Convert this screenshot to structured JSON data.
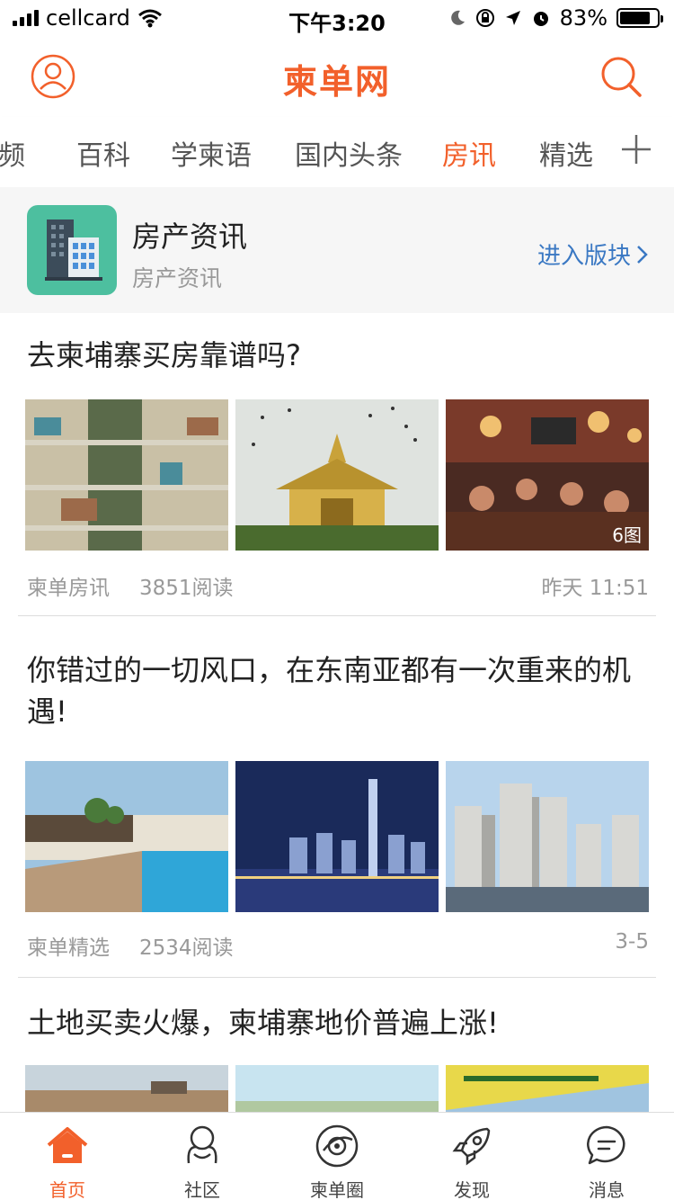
{
  "status_bar": {
    "carrier": "cellcard",
    "time": "下午3:20",
    "battery": "83%",
    "battery_level": 0.83
  },
  "header": {
    "logo": "柬单网",
    "profile_icon": "user-icon",
    "search_icon": "search-icon"
  },
  "tabs": [
    {
      "label": "视频"
    },
    {
      "label": "百科"
    },
    {
      "label": "学柬语"
    },
    {
      "label": "国内头条"
    },
    {
      "label": "房讯",
      "active": true
    },
    {
      "label": "精选"
    }
  ],
  "section": {
    "title": "房产资讯",
    "subtitle": "房产资讯",
    "enter_label": "进入版块"
  },
  "articles": [
    {
      "headline": "去柬埔寨买房靠谱吗?",
      "source": "柬单房讯",
      "reads": "3851阅读",
      "time": "昨天 11:51",
      "image_badge": "6图"
    },
    {
      "headline": "你错过的一切风口，在东南亚都有一次重来的机遇!",
      "source": "柬单精选",
      "reads": "2534阅读",
      "time": "3-5"
    },
    {
      "headline": "土地买卖火爆，柬埔寨地价普遍上涨!"
    }
  ],
  "bottom_nav": [
    {
      "label": "首页",
      "icon": "home-icon",
      "active": true
    },
    {
      "label": "社区",
      "icon": "community-icon"
    },
    {
      "label": "柬单圈",
      "icon": "circle-icon"
    },
    {
      "label": "发现",
      "icon": "rocket-icon"
    },
    {
      "label": "消息",
      "icon": "message-icon"
    }
  ],
  "colors": {
    "accent": "#f2602b",
    "link": "#3a78c3",
    "section_bg": "#f6f6f6",
    "thumb_bg": "#4dbf9f"
  }
}
